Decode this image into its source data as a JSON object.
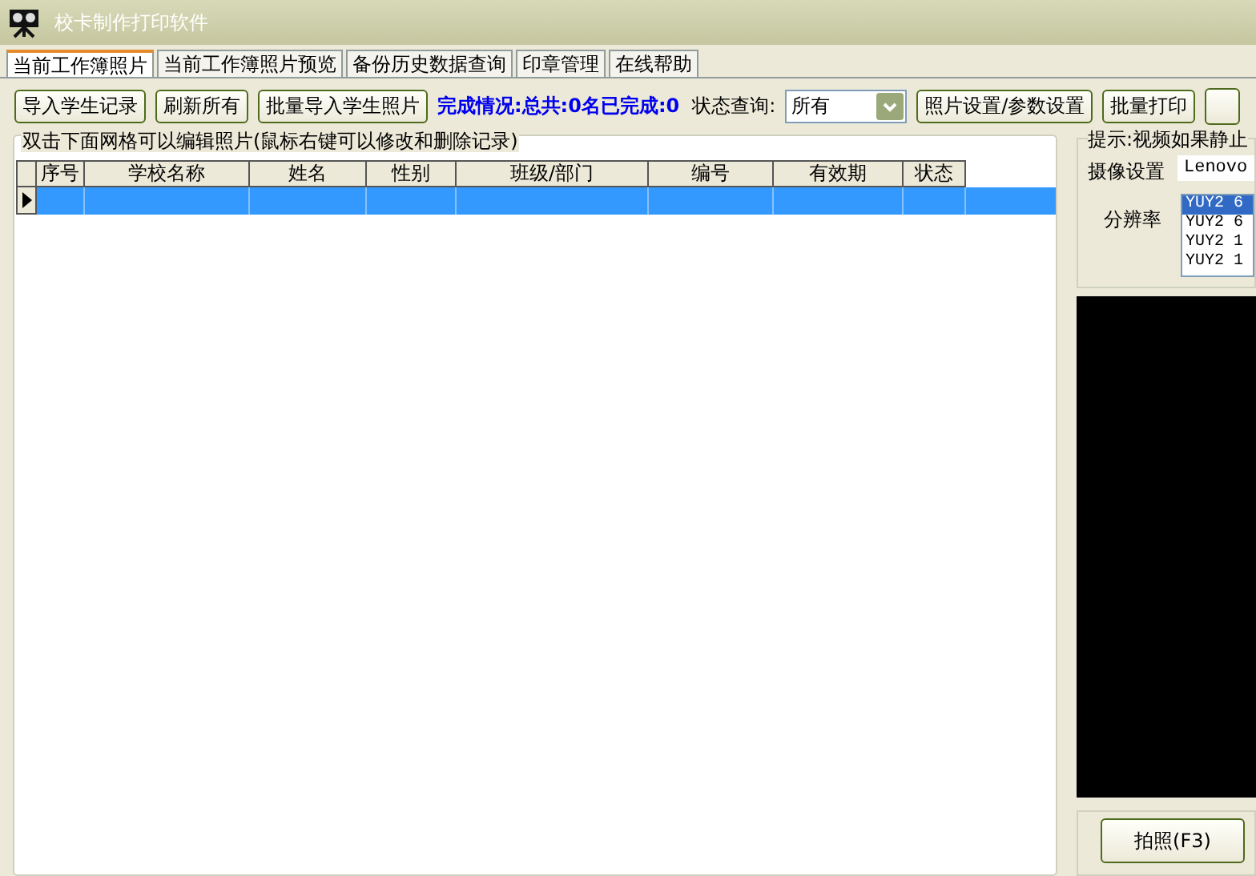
{
  "window": {
    "title": "校卡制作打印软件"
  },
  "tabs": [
    {
      "label": "当前工作簿照片",
      "selected": true
    },
    {
      "label": "当前工作簿照片预览",
      "selected": false
    },
    {
      "label": "备份历史数据查询",
      "selected": false
    },
    {
      "label": "印章管理",
      "selected": false
    },
    {
      "label": "在线帮助",
      "selected": false
    }
  ],
  "toolbar": {
    "buttons_left": [
      "导入学生记录",
      "刷新所有",
      "批量导入学生照片"
    ],
    "status": "完成情况:总共:0名已完成:0",
    "filter_label": "状态查询:",
    "filter_value": "所有",
    "buttons_right": [
      "照片设置/参数设置",
      "批量打印"
    ]
  },
  "grid_group": {
    "title": "双击下面网格可以编辑照片(鼠标右键可以修改和删除记录)"
  },
  "table": {
    "columns": [
      "序号",
      "学校名称",
      "姓名",
      "性别",
      "班级/部门",
      "编号",
      "有效期",
      "状态"
    ],
    "rows": [
      {
        "selected": true
      }
    ]
  },
  "camera": {
    "hint": "提示:视频如果静止",
    "device_label": "摄像设置",
    "device_value": "Lenovo",
    "resolution_label": "分辨率",
    "resolutions": [
      {
        "label": "YUY2 6",
        "selected": true
      },
      {
        "label": "YUY2 6",
        "selected": false
      },
      {
        "label": "YUY2 1",
        "selected": false
      },
      {
        "label": "YUY2 1",
        "selected": false
      }
    ],
    "capture_button": "拍照(F3)"
  }
}
